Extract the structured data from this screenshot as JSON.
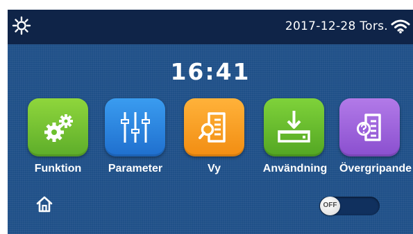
{
  "topbar": {
    "date": "2017-12-28",
    "weekday": "Tors.",
    "left_icon": "sun-settings-icon",
    "right_icon": "wifi-icon"
  },
  "clock": {
    "time": "16:41"
  },
  "menu": {
    "items": [
      {
        "label": "Funktion",
        "icon": "gears-icon",
        "color": "#6cc12e"
      },
      {
        "label": "Parameter",
        "icon": "sliders-icon",
        "color": "#2d86e3"
      },
      {
        "label": "Vy",
        "icon": "document-search-icon",
        "color": "#f7a21f"
      },
      {
        "label": "Användning",
        "icon": "download-tray-icon",
        "color": "#66bb2a"
      },
      {
        "label": "Övergripande",
        "icon": "document-help-icon",
        "color": "#9b61dc"
      }
    ]
  },
  "bottom": {
    "home_icon": "home-icon",
    "power_toggle": {
      "label": "OFF",
      "state": "off"
    }
  }
}
